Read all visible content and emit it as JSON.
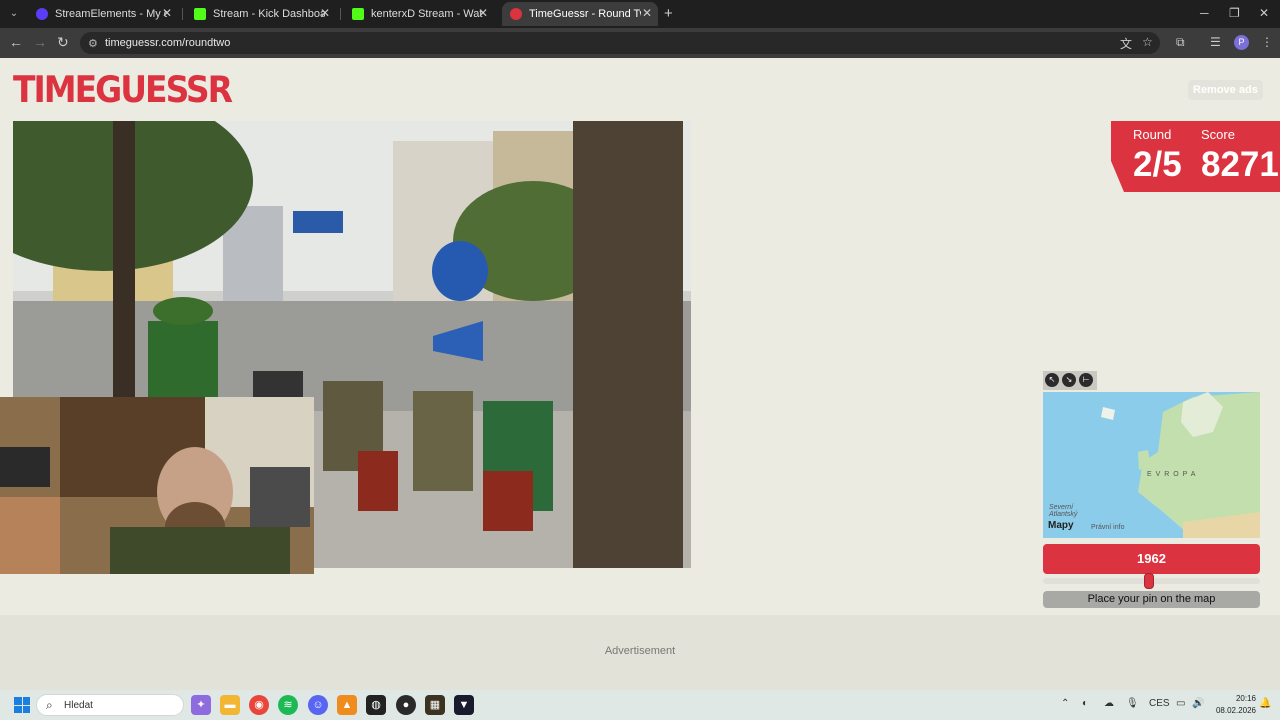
{
  "browser": {
    "tabs": [
      {
        "title": "StreamElements - My dashboard",
        "favicon_color": "#5b3df5"
      },
      {
        "title": "Stream - Kick Dashboard",
        "favicon_color": "#53fc18"
      },
      {
        "title": "kenterxD Stream - Watch Live o",
        "favicon_color": "#53fc18"
      },
      {
        "title": "TimeGuessr - Round Two",
        "favicon_color": "#db3340"
      }
    ],
    "url": "timeguessr.com/roundtwo",
    "profile_initial": "P"
  },
  "page": {
    "logo": "TIMEGUESSR",
    "remove_ads": "Remove ads",
    "round_label": "Round",
    "round_value": "2/5",
    "score_label": "Score",
    "score_value": "8271",
    "map": {
      "region_label": "E V R O P A",
      "ocean_label": "Severní Atlantský",
      "attribution": "Mapy",
      "legal": "Právní info"
    },
    "year": "1962",
    "year_slider_fraction": 0.49,
    "pin_prompt": "Place your pin on the map",
    "advertisement": "Advertisement"
  },
  "taskbar": {
    "search_placeholder": "Hledat",
    "language": "CES",
    "time": "20:16",
    "date": "08.02.2026"
  },
  "colors": {
    "accent": "#db3340",
    "page_bg": "#ecebe2",
    "chrome_dark": "#1f1f1f"
  }
}
